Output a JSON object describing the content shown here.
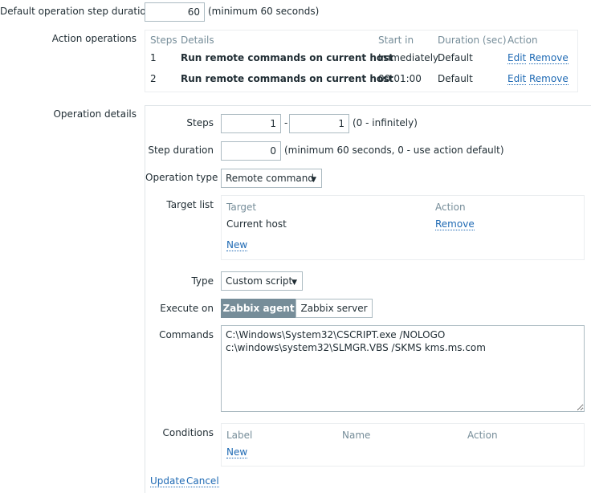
{
  "default_step": {
    "label": "Default operation step duration",
    "value": "60",
    "hint": "(minimum 60 seconds)"
  },
  "action_operations": {
    "label": "Action operations",
    "headers": [
      "Steps",
      "Details",
      "Start in",
      "Duration (sec)",
      "Action"
    ],
    "rows": [
      {
        "step": "1",
        "details": "Run remote commands on current host",
        "start": "Immediately",
        "duration": "Default",
        "edit": "Edit",
        "remove": "Remove"
      },
      {
        "step": "2",
        "details": "Run remote commands on current host",
        "start": "00:01:00",
        "duration": "Default",
        "edit": "Edit",
        "remove": "Remove"
      }
    ]
  },
  "operation_details": {
    "label": "Operation details",
    "steps": {
      "label": "Steps",
      "from": "1",
      "separator": "-",
      "to": "1",
      "hint": "(0 - infinitely)"
    },
    "step_duration": {
      "label": "Step duration",
      "value": "0",
      "hint": "(minimum 60 seconds, 0 - use action default)"
    },
    "operation_type": {
      "label": "Operation type",
      "selected": "Remote command"
    },
    "target_list": {
      "label": "Target list",
      "headers": [
        "Target",
        "Action"
      ],
      "rows": [
        {
          "target": "Current host",
          "action": "Remove"
        }
      ],
      "new_link": "New"
    },
    "type": {
      "label": "Type",
      "selected": "Custom script"
    },
    "execute_on": {
      "label": "Execute on",
      "options": [
        "Zabbix agent",
        "Zabbix server"
      ],
      "selected": "Zabbix agent"
    },
    "commands": {
      "label": "Commands",
      "value": "C:\\Windows\\System32\\CSCRIPT.exe /NOLOGO\nc:\\windows\\system32\\SLMGR.VBS /SKMS kms.ms.com"
    },
    "conditions": {
      "label": "Conditions",
      "headers": [
        "Label",
        "Name",
        "Action"
      ],
      "new_link": "New"
    },
    "footer": {
      "update": "Update",
      "cancel": "Cancel"
    }
  },
  "colors": {
    "link": "#1f6ab4",
    "header_text": "#768d99",
    "active_segment": "#768d99",
    "border": "#acbbc2"
  },
  "icons": {
    "select_arrow": "triangle-down-icon"
  }
}
